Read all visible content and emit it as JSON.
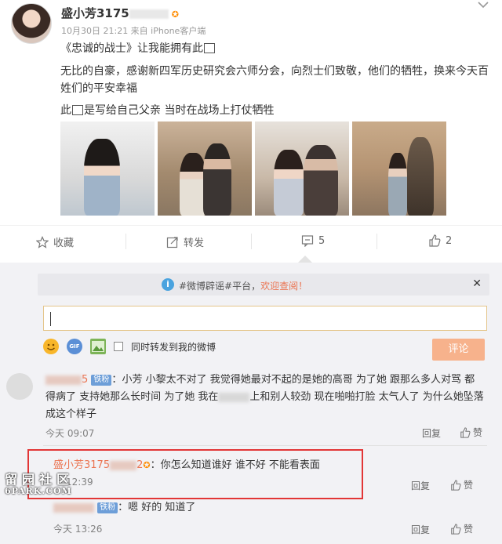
{
  "post": {
    "author": "盛小芳3175",
    "meta": "10月30日 21:21 来自 iPhone客户端",
    "line1_a": "《忠诚的战士》让我能拥有此",
    "line2": "无比的自豪，感谢新四军历史研究会六师分会，向烈士们致敬，他们的牺牲，换来今天百姓们的平安幸福",
    "line3_a": "此",
    "line3_b": "是写给自己父亲 当时在战场上打仗牺牲",
    "actions": {
      "favorite": "收藏",
      "repost": "转发",
      "comment": "5",
      "like": "2"
    }
  },
  "comments_panel": {
    "notice_tag": "#微博辟谣#平台，",
    "notice_link": "欢迎查阅！",
    "share_option": "同时转发到我的微博",
    "submit": "评论",
    "colors": {
      "accent": "#eb7350",
      "highlight_box": "#e23636",
      "fan_badge": "#6d9ed8"
    },
    "comments": [
      {
        "name": "5",
        "badge": "铁粉",
        "text": "小芳 小黎太不对了 我觉得她最对不起的是她的高哥 为了她 跟那么多人对骂 都得病了 支持她那么长时间 为了她 我在",
        "text2": "上和别人较劲 现在啪啪打脸 太气人了 为什么她坠落成这个样子",
        "time": "今天 09:07",
        "reply": "回复",
        "like": "赞"
      },
      {
        "name": "盛小芳3175",
        "name_tail": "2",
        "text": "你怎么知道谁好 谁不好 不能看表面",
        "time": "12:39",
        "reply": "回复",
        "like": "赞"
      },
      {
        "badge": "铁粉",
        "text": "嗯 好的 知道了",
        "time": "今天 13:26",
        "reply": "回复",
        "like": "赞"
      }
    ]
  },
  "watermark": {
    "top": "留园社区",
    "bottom": "6PARK.COM"
  }
}
